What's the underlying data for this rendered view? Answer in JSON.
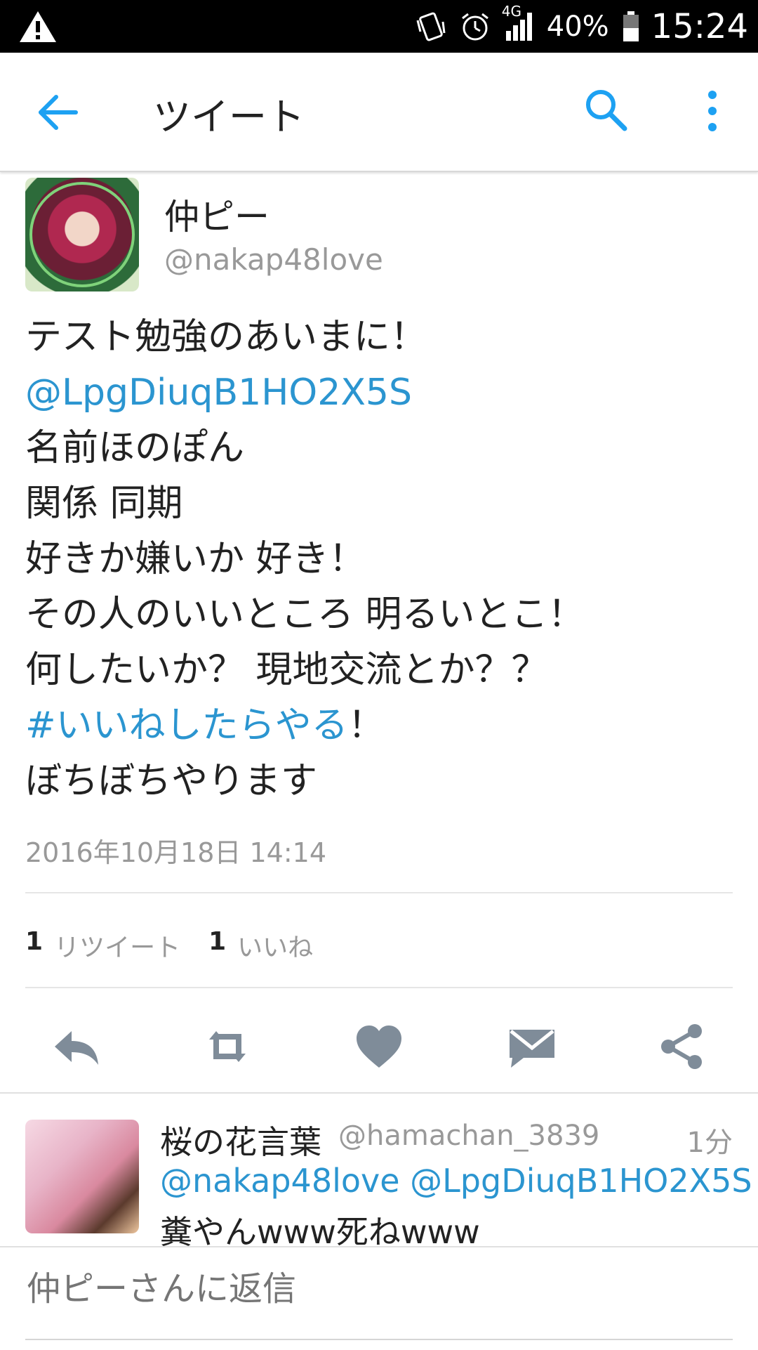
{
  "status_bar": {
    "network": "4G",
    "battery": "40%",
    "time": "15:24"
  },
  "header": {
    "title": "ツイート"
  },
  "tweet": {
    "display_name": "仲ピー",
    "handle": "@nakap48love",
    "lines": [
      {
        "text": "テスト勉強のあいまに！"
      },
      {
        "link": "@LpgDiuqB1HO2X5S"
      },
      {
        "text": "名前ほのぽん"
      },
      {
        "text": "関係 同期"
      },
      {
        "text": "好きか嫌いか 好き！"
      },
      {
        "text": "その人のいいところ 明るいとこ！"
      },
      {
        "text": "何したいか？ 現地交流とか？？"
      },
      {
        "link": "#いいねしたらやる",
        "text": "！"
      },
      {
        "text": "ぼちぼちやります"
      }
    ],
    "timestamp": "2016年10月18日 14:14",
    "stats": {
      "retweet_count": "1",
      "retweet_label": "リツイート",
      "like_count": "1",
      "like_label": "いいね"
    }
  },
  "reply": {
    "display_name": "桜の花言葉",
    "handle": "@hamachan_3839",
    "time": "1分",
    "mentions": "@nakap48love @LpgDiuqB1HO2X5S",
    "body": "糞やんwww死ねwww"
  },
  "compose": {
    "placeholder": "仲ピーさんに返信"
  },
  "colors": {
    "link": "#2b95d0",
    "icon": "#7f8c99",
    "accent": "#1da1f2"
  }
}
